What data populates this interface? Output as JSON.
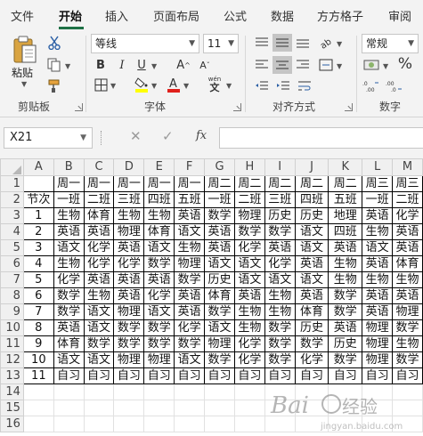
{
  "ribbon_tabs": [
    "文件",
    "开始",
    "插入",
    "页面布局",
    "公式",
    "数据",
    "方方格子",
    "审阅"
  ],
  "active_tab": "开始",
  "clipboard": {
    "paste_label": "粘贴",
    "group_label": "剪贴板"
  },
  "font": {
    "name": "等线",
    "size": "11",
    "group_label": "字体",
    "pinyin_label": "wén"
  },
  "alignment": {
    "group_label": "对齐方式"
  },
  "number": {
    "format": "常规",
    "group_label": "数字"
  },
  "formula_bar": {
    "name_box": "X21",
    "fx_label": "fx",
    "formula": ""
  },
  "sheet": {
    "columns": [
      "A",
      "B",
      "C",
      "D",
      "E",
      "F",
      "G",
      "H",
      "I",
      "J",
      "K",
      "L",
      "M"
    ],
    "row_numbers": [
      "1",
      "2",
      "3",
      "4",
      "5",
      "6",
      "7",
      "8",
      "9",
      "10",
      "11",
      "12",
      "13",
      "14",
      "15",
      "16"
    ],
    "rows": [
      [
        "",
        "周一",
        "周一",
        "周一",
        "周一",
        "周一",
        "周二",
        "周二",
        "周二",
        "周二",
        "周二",
        "周三",
        "周三"
      ],
      [
        "节次",
        "一班",
        "二班",
        "三班",
        "四班",
        "五班",
        "一班",
        "二班",
        "三班",
        "四班",
        "五班",
        "一班",
        "二班"
      ],
      [
        "1",
        "生物",
        "体育",
        "生物",
        "生物",
        "英语",
        "数学",
        "物理",
        "历史",
        "历史",
        "地理",
        "英语",
        "化学",
        "化学"
      ],
      [
        "2",
        "英语",
        "英语",
        "物理",
        "体育",
        "语文",
        "英语",
        "数学",
        "数学",
        "语文",
        "四班",
        "生物",
        "英语"
      ],
      [
        "3",
        "语文",
        "化学",
        "英语",
        "语文",
        "生物",
        "英语",
        "化学",
        "英语",
        "语文",
        "英语",
        "语文",
        "英语"
      ],
      [
        "4",
        "生物",
        "化学",
        "化学",
        "数学",
        "物理",
        "语文",
        "语文",
        "化学",
        "英语",
        "生物",
        "英语",
        "体育"
      ],
      [
        "5",
        "化学",
        "英语",
        "英语",
        "英语",
        "数学",
        "历史",
        "语文",
        "语文",
        "语文",
        "生物",
        "生物",
        "生物"
      ],
      [
        "6",
        "数学",
        "生物",
        "英语",
        "化学",
        "英语",
        "体育",
        "英语",
        "生物",
        "英语",
        "数学",
        "英语",
        "英语"
      ],
      [
        "7",
        "数学",
        "语文",
        "物理",
        "语文",
        "英语",
        "数学",
        "生物",
        "生物",
        "体育",
        "数学",
        "英语",
        "物理"
      ],
      [
        "8",
        "英语",
        "语文",
        "数学",
        "数学",
        "化学",
        "语文",
        "生物",
        "数学",
        "历史",
        "英语",
        "物理",
        "数学"
      ],
      [
        "9",
        "体育",
        "数学",
        "数学",
        "数学",
        "数学",
        "物理",
        "化学",
        "数学",
        "数学",
        "历史",
        "物理",
        "生物"
      ],
      [
        "10",
        "语文",
        "语文",
        "物理",
        "物理",
        "语文",
        "数学",
        "化学",
        "数学",
        "化学",
        "数学",
        "物理",
        "数学"
      ],
      [
        "11",
        "自习",
        "自习",
        "自习",
        "自习",
        "自习",
        "自习",
        "自习",
        "自习",
        "自习",
        "自习",
        "自习",
        "自习"
      ]
    ]
  },
  "colors": {
    "accent": "#1e7145",
    "highlight": "#ffff00",
    "font_color": "#e0201b"
  }
}
